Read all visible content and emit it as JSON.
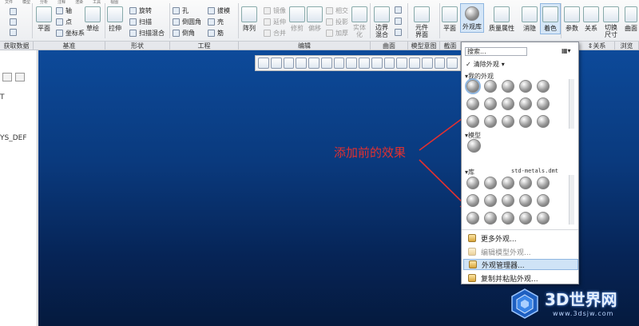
{
  "ribbon": {
    "file_tabs": [
      "文件",
      "模型",
      "分析",
      "注释",
      "渲染",
      "工具",
      "视图"
    ],
    "buttons": {
      "plane": "平面",
      "sketch": "草绘",
      "extrude": "拉伸",
      "pattern": "阵列",
      "trim": "修剪",
      "offset": "偏移",
      "solidify": "实体\n化",
      "boundary_blend": "边界\n混合",
      "component_interface": "元件\n界面",
      "section_plane": "平面",
      "appearance_gallery": "外观库",
      "mass_props": "质量属性",
      "hide": "消隐",
      "color": "着色",
      "params": "参数",
      "relations": "关系",
      "switch_dims": "切换\n尺寸",
      "curve": "曲面"
    },
    "small": {
      "axis": "轴",
      "point": "点",
      "csys": "坐标系",
      "revolve": "旋转",
      "sweep": "扫描",
      "swept_blend": "扫描混合",
      "hole": "孔",
      "round": "倒圆角",
      "chamfer": "倒角",
      "draft": "拔模",
      "shell": "壳",
      "rib": "筋",
      "mirror": "镜像",
      "extend": "延伸",
      "merge": "合并",
      "intersect": "相交",
      "project": "投影",
      "thicken": "加厚"
    },
    "groups": [
      "获取数据",
      "基准",
      "形状",
      "工程",
      "编辑",
      "曲面",
      "模型意图",
      "截面",
      "⇕关系",
      "浏览"
    ]
  },
  "left_panel": {
    "items": [
      "T",
      "YS_DEF"
    ]
  },
  "annotation": {
    "text": "添加前的效果",
    "color": "#e23030"
  },
  "popup": {
    "search_placeholder": "搜索...",
    "clear_label": "清除外观",
    "my_appearances_label": "▾我的外观",
    "model_label": "▾模型",
    "library_label": "▾库",
    "library_file": "std-metals.dmt",
    "my_count": 15,
    "lib_count": 15,
    "menu": [
      {
        "label": "更多外观...",
        "disabled": false,
        "highlighted": false
      },
      {
        "label": "编辑模型外观...",
        "disabled": true,
        "highlighted": false
      },
      {
        "label": "外观管理器...",
        "disabled": false,
        "highlighted": true
      },
      {
        "label": "复制并粘贴外观...",
        "disabled": false,
        "highlighted": false
      }
    ]
  },
  "watermark": {
    "title": "3D世界网",
    "url": "www.3dsjw.com"
  },
  "colors": {
    "viewport_top": "#0d4a9a",
    "viewport_bottom": "#051a3e",
    "highlight": "#cfe3f6"
  }
}
